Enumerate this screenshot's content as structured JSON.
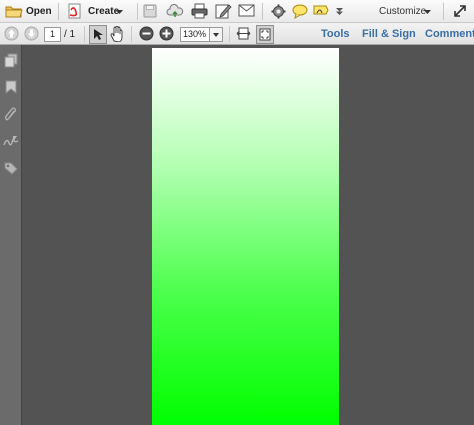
{
  "toolbar": {
    "open_label": "Open",
    "create_label": "Create",
    "customize_label": "Customize",
    "icons": [
      "folder-icon",
      "create-pdf-icon",
      "save-icon",
      "cloud-upload-icon",
      "print-icon",
      "edit-icon",
      "email-icon",
      "gear-icon",
      "comment-icon",
      "sign-icon",
      "overflow-icon",
      "expand-icon"
    ]
  },
  "nav": {
    "page_current": "1",
    "page_total": "/ 1",
    "zoom": "130%"
  },
  "tabs": [
    {
      "label": "Tools"
    },
    {
      "label": "Fill & Sign"
    },
    {
      "label": "Comment"
    }
  ],
  "sidebar": {
    "icons": [
      "pages-icon",
      "bookmark-icon",
      "attachment-icon",
      "signature-icon",
      "tag-icon"
    ]
  },
  "colors": {
    "workspace": "#535353",
    "page_top": "#ffffff",
    "page_bottom": "#00ff00",
    "tab_text": "#3a6ea5"
  }
}
